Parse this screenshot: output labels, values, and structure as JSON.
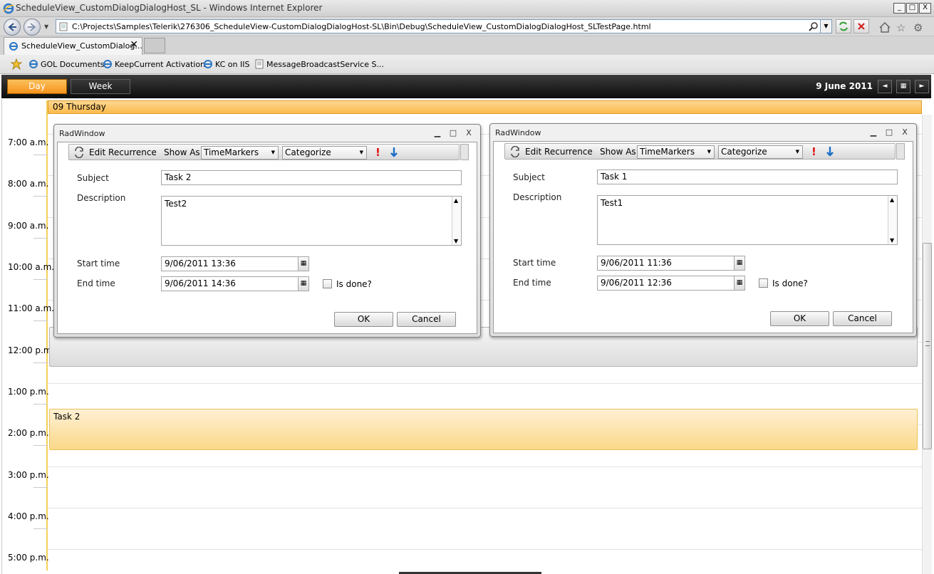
{
  "browser": {
    "title": "ScheduleView_CustomDialogDialogHost_SL - Windows Internet Explorer",
    "window_buttons": [
      "_",
      "□",
      "X"
    ],
    "url": "C:\\Projects\\Samples\\Telerik\\276306_ScheduleView-CustomDialogDialogHost-SL\\Bin\\Debug\\ScheduleView_CustomDialogDialogHost_SLTestPage.html",
    "tab_label": "ScheduleView_CustomDialog...",
    "tab_close": "✕",
    "favorites": [
      "GOL Documents",
      "KeepCurrent Activation",
      "KC on IIS",
      "MessageBroadcastService S..."
    ]
  },
  "scheduler": {
    "views": {
      "day": "Day",
      "week": "Week"
    },
    "current_date": "9 June 2011",
    "day_header": "09 Thursday",
    "hours": [
      "7:00 a.m.",
      "8:00 a.m.",
      "9:00 a.m.",
      "10:00 a.m.",
      "11:00 a.m.",
      "12:00 p.m.",
      "1:00 p.m.",
      "2:00 p.m.",
      "3:00 p.m.",
      "4:00 p.m.",
      "5:00 p.m."
    ],
    "appointment": "Task 2"
  },
  "dialogs": [
    {
      "title": "RadWindow",
      "toolbar": {
        "edit_recurrence": "Edit Recurrence",
        "show_as": "Show As",
        "show_as_value": "TimeMarkers",
        "categorize": "Categorize"
      },
      "labels": {
        "subject": "Subject",
        "description": "Description",
        "start": "Start time",
        "end": "End time",
        "is_done": "Is done?"
      },
      "subject": "Task 2",
      "description": "Test2",
      "start_time": "9/06/2011 13:36",
      "end_time": "9/06/2011 14:36",
      "ok": "OK",
      "cancel": "Cancel"
    },
    {
      "title": "RadWindow",
      "toolbar": {
        "edit_recurrence": "Edit Recurrence",
        "show_as": "Show As",
        "show_as_value": "TimeMarkers",
        "categorize": "Categorize"
      },
      "labels": {
        "subject": "Subject",
        "description": "Description",
        "start": "Start time",
        "end": "End time",
        "is_done": "Is done?"
      },
      "subject": "Task 1",
      "description": "Test1",
      "start_time": "9/06/2011 11:36",
      "end_time": "9/06/2011 12:36",
      "ok": "OK",
      "cancel": "Cancel"
    }
  ],
  "colors": {
    "accent_orange": "#f6931c",
    "appointment_fill": "#fbd98a",
    "toolbar_dark": "#0d0d0d",
    "priority_red": "#e01414"
  }
}
